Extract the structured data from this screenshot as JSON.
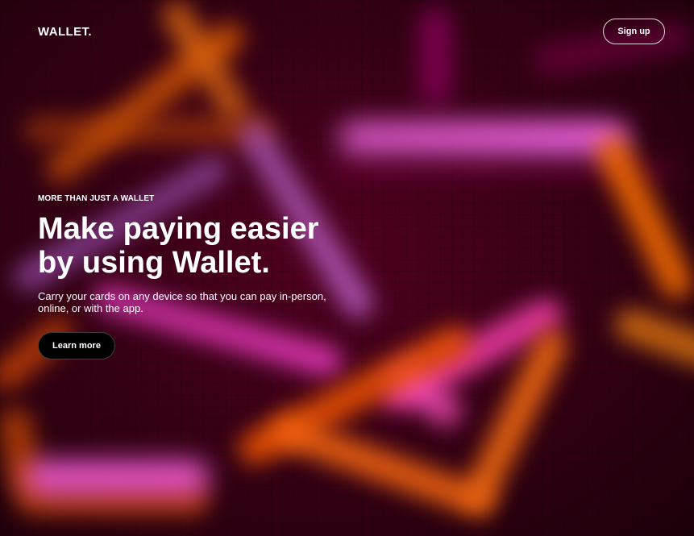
{
  "header": {
    "logo": "WALLET.",
    "signup_label": "Sign up"
  },
  "hero": {
    "eyebrow": "MORE THAN JUST A WALLET",
    "headline": "Make paying easier by using Wallet.",
    "subtext": "Carry your cards on any device so that you can pay in-person, online, or with the app.",
    "cta_label": "Learn more"
  },
  "colors": {
    "background": "#3a0016",
    "neon_orange": "#ff6a00",
    "neon_pink": "#ff6af0",
    "text": "#ffffff",
    "cta_background": "#000000"
  }
}
